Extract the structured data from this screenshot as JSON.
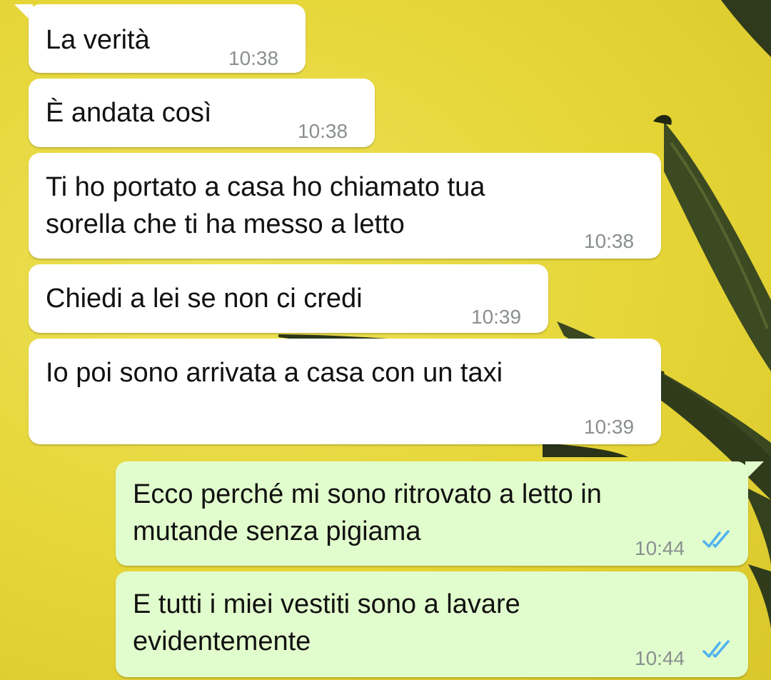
{
  "messages": [
    {
      "direction": "incoming",
      "text": "La verità",
      "time": "10:38"
    },
    {
      "direction": "incoming",
      "text": "È andata così",
      "time": "10:38"
    },
    {
      "direction": "incoming",
      "text": "Ti ho portato a casa ho chiamato tua\nsorella che ti ha messo a letto",
      "time": "10:38"
    },
    {
      "direction": "incoming",
      "text": "Chiedi a lei se non ci credi",
      "time": "10:39"
    },
    {
      "direction": "incoming",
      "text": "Io poi sono arrivata a casa con un taxi",
      "time": "10:39"
    },
    {
      "direction": "outgoing",
      "text": "Ecco perché mi sono ritrovato a letto in\nmutande senza pigiama",
      "time": "10:44",
      "status": "read"
    },
    {
      "direction": "outgoing",
      "text": "E tutti i miei vestiti sono a lavare\nevidentemente",
      "time": "10:44",
      "status": "read"
    }
  ],
  "colors": {
    "incoming_bubble": "#ffffff",
    "outgoing_bubble": "#e2fdcd",
    "read_ticks": "#4fb3f0",
    "wallpaper": "#e7d93a"
  },
  "icons": {
    "read_status": "double-check-icon",
    "wallpaper": "banana-leaf-wallpaper"
  }
}
